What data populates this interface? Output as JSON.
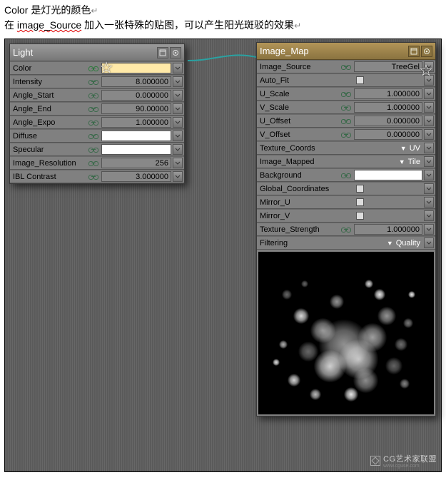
{
  "description": {
    "line1_pre": "Color 是灯光的颜色",
    "line2_pre": "在 ",
    "line2_under": "image_Source",
    "line2_post": " 加入一张特殊的贴图，可以产生阳光斑驳的效果"
  },
  "light_panel": {
    "title": "Light",
    "rows": [
      {
        "label": "Color",
        "type": "color",
        "value": "",
        "field_bg": "cream"
      },
      {
        "label": "Intensity",
        "type": "num",
        "value": "8.000000"
      },
      {
        "label": "Angle_Start",
        "type": "num",
        "value": "0.000000"
      },
      {
        "label": "Angle_End",
        "type": "num",
        "value": "90.00000"
      },
      {
        "label": "Angle_Expo",
        "type": "num",
        "value": "1.000000"
      },
      {
        "label": "Diffuse",
        "type": "color",
        "value": "",
        "field_bg": "white"
      },
      {
        "label": "Specular",
        "type": "color",
        "value": "",
        "field_bg": "white"
      },
      {
        "label": "Image_Resolution",
        "type": "num",
        "value": "256"
      },
      {
        "label": "IBL Contrast",
        "type": "num",
        "value": "3.000000"
      }
    ]
  },
  "map_panel": {
    "title": "Image_Map",
    "rows": [
      {
        "label": "Image_Source",
        "type": "text",
        "value": "TreeGel"
      },
      {
        "label": "Auto_Fit",
        "type": "check",
        "value": ""
      },
      {
        "label": "U_Scale",
        "type": "num",
        "value": "1.000000"
      },
      {
        "label": "V_Scale",
        "type": "num",
        "value": "1.000000"
      },
      {
        "label": "U_Offset",
        "type": "num",
        "value": "0.000000"
      },
      {
        "label": "V_Offset",
        "type": "num",
        "value": "0.000000"
      },
      {
        "label": "Texture_Coords",
        "type": "dd",
        "value": "UV"
      },
      {
        "label": "Image_Mapped",
        "type": "dd",
        "value": "Tile"
      },
      {
        "label": "Background",
        "type": "color",
        "value": "",
        "field_bg": "white"
      },
      {
        "label": "Global_Coordinates",
        "type": "check",
        "value": ""
      },
      {
        "label": "Mirror_U",
        "type": "check",
        "value": ""
      },
      {
        "label": "Mirror_V",
        "type": "check",
        "value": ""
      },
      {
        "label": "Texture_Strength",
        "type": "num",
        "value": "1.000000"
      },
      {
        "label": "Filtering",
        "type": "dd",
        "value": "Quality"
      }
    ]
  },
  "watermark": {
    "line1": "CG艺术家联盟",
    "line2": "www.cguse.com"
  }
}
